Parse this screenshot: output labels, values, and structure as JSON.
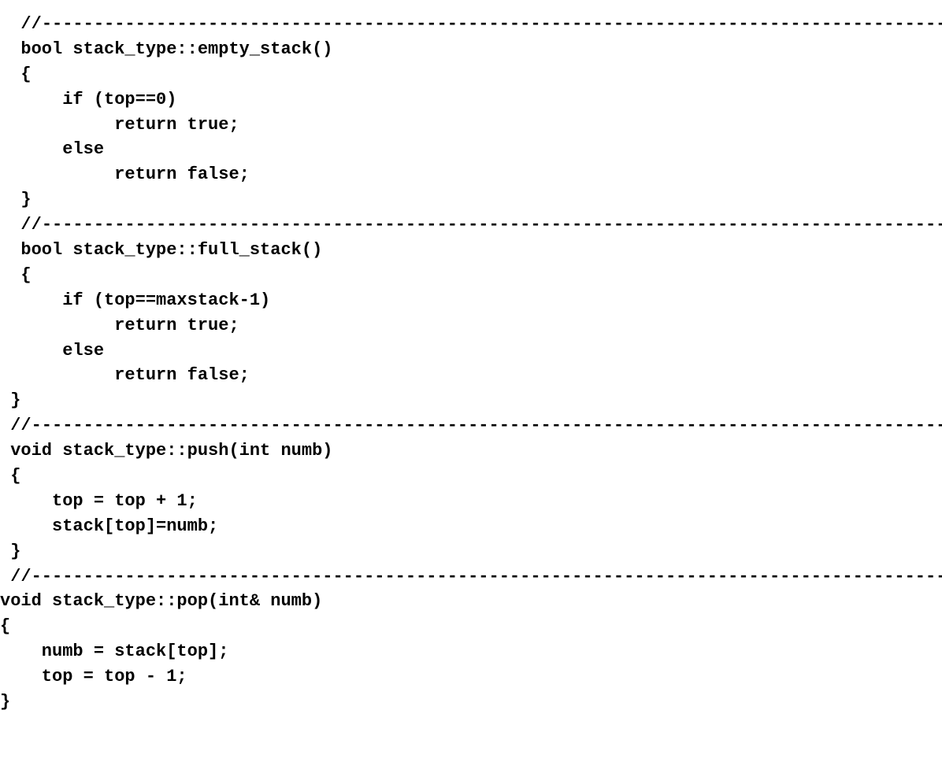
{
  "code": {
    "indent0": "  ",
    "indent1": " ",
    "indent2": " ",
    "indent3": "",
    "sep_prefix0": "  //",
    "sep_prefix1": "  //",
    "sep_prefix2": " //",
    "sep_prefix3": " //",
    "dashes": "---------------------------------------------------------------------------------------------",
    "fn_empty": {
      "sig": "  bool stack_type::empty_stack()",
      "open": "  {",
      "l1": "      if (top==0)",
      "l2": "           return true;",
      "l3": "      else",
      "l4": "           return false;",
      "close": "  }"
    },
    "fn_full": {
      "sig": "  bool stack_type::full_stack()",
      "open": "  {",
      "l1": "      if (top==maxstack-1)",
      "l2": "           return true;",
      "l3": "      else",
      "l4": "           return false;",
      "close": " }"
    },
    "fn_push": {
      "sig": " void stack_type::push(int numb)",
      "open": " {",
      "l1": "     top = top + 1;",
      "l2": "     stack[top]=numb;",
      "close": " }"
    },
    "fn_pop": {
      "sig": "void stack_type::pop(int& numb)",
      "open": "{",
      "l1": "    numb = stack[top];",
      "l2": "    top = top - 1;",
      "close": "}"
    }
  }
}
